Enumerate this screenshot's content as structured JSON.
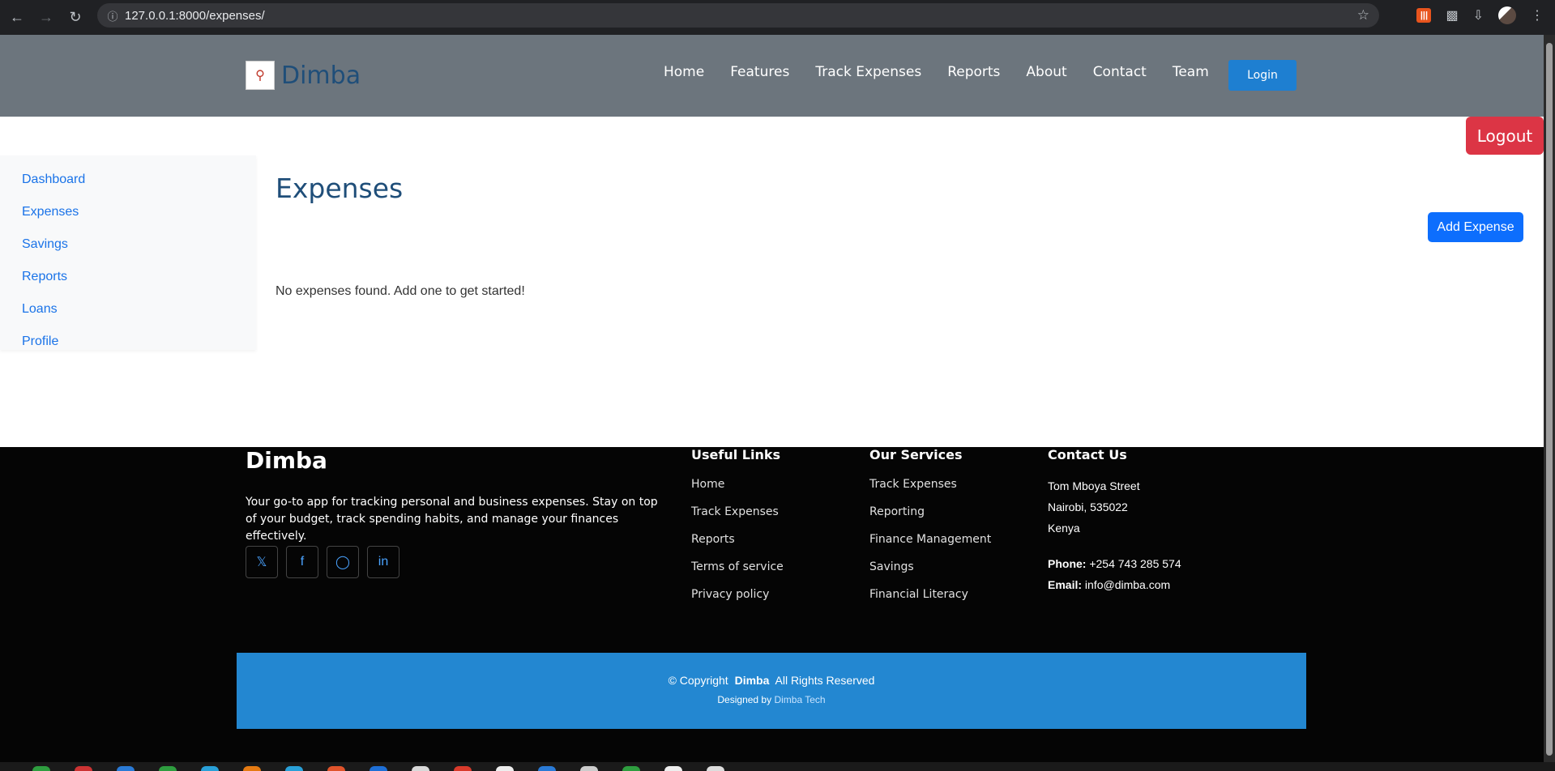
{
  "browser": {
    "url": "127.0.0.1:8000/expenses/"
  },
  "header": {
    "brand": "Dimba",
    "nav": [
      "Home",
      "Features",
      "Track Expenses",
      "Reports",
      "About",
      "Contact",
      "Team"
    ],
    "login_label": "Login"
  },
  "logout_label": "Logout",
  "sidebar": {
    "items": [
      "Dashboard",
      "Expenses",
      "Savings",
      "Reports",
      "Loans",
      "Profile"
    ]
  },
  "main": {
    "title": "Expenses",
    "add_label": "Add Expense",
    "empty_message": "No expenses found. Add one to get started!"
  },
  "footer": {
    "brand": "Dimba",
    "description": "Your go-to app for tracking personal and business expenses. Stay on top of your budget, track spending habits, and manage your finances effectively.",
    "useful_links": {
      "heading": "Useful Links",
      "items": [
        "Home",
        "Track Expenses",
        "Reports",
        "Terms of service",
        "Privacy policy"
      ]
    },
    "services": {
      "heading": "Our Services",
      "items": [
        "Track Expenses",
        "Reporting",
        "Finance Management",
        "Savings",
        "Financial Literacy"
      ]
    },
    "contact": {
      "heading": "Contact Us",
      "street": "Tom Mboya Street",
      "city": "Nairobi, 535022",
      "country": "Kenya",
      "phone_label": "Phone:",
      "phone": "+254 743 285 574",
      "email_label": "Email:",
      "email": "info@dimba.com"
    },
    "copyright_prefix": "© Copyright",
    "copyright_brand": "Dimba",
    "copyright_suffix": "All Rights Reserved",
    "designed_by": "Designed by",
    "designer": "Dimba Tech"
  },
  "colors": {
    "header_bg": "#6c757d",
    "link_blue": "#1a73e8",
    "logout_red": "#dc3545",
    "primary_blue": "#0d6efd",
    "footer_bar": "#2387d1"
  }
}
